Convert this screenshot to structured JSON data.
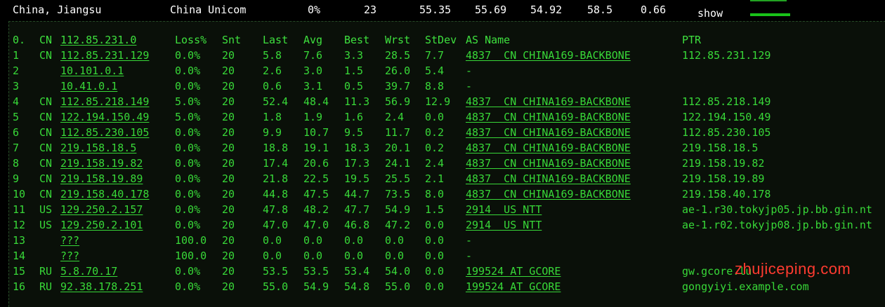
{
  "summary": {
    "location": "China, Jiangsu",
    "isp": "China Unicom",
    "loss": "0%",
    "sent": "23",
    "last": "55.35",
    "avg": "55.69",
    "best": "54.92",
    "worst": "58.5",
    "stdev": "0.66",
    "show_label": "show"
  },
  "table": {
    "headers": {
      "hop": "0.",
      "cc": "CN",
      "host": "112.85.231.0",
      "loss": "Loss%",
      "snt": "Snt",
      "last": "Last",
      "avg": "Avg",
      "best": "Best",
      "wrst": "Wrst",
      "stdev": "StDev",
      "asname": "AS Name",
      "ptr": "PTR"
    },
    "rows": [
      {
        "hop": "1",
        "cc": "CN",
        "host": "112.85.231.129",
        "loss": "0.0%",
        "snt": "20",
        "last": "5.8",
        "avg": "7.6",
        "best": "3.3",
        "wrst": "28.5",
        "stdev": "7.7",
        "asname": "4837  CN CHINA169-BACKBONE",
        "ptr": "112.85.231.129"
      },
      {
        "hop": "2",
        "cc": "",
        "host": "10.101.0.1",
        "loss": "0.0%",
        "snt": "20",
        "last": "2.6",
        "avg": "3.0",
        "best": "1.5",
        "wrst": "26.0",
        "stdev": "5.4",
        "asname": "-",
        "ptr": ""
      },
      {
        "hop": "3",
        "cc": "",
        "host": "10.41.0.1",
        "loss": "0.0%",
        "snt": "20",
        "last": "0.6",
        "avg": "3.1",
        "best": "0.5",
        "wrst": "39.7",
        "stdev": "8.8",
        "asname": "-",
        "ptr": ""
      },
      {
        "hop": "4",
        "cc": "CN",
        "host": "112.85.218.149",
        "loss": "5.0%",
        "snt": "20",
        "last": "52.4",
        "avg": "48.4",
        "best": "11.3",
        "wrst": "56.9",
        "stdev": "12.9",
        "asname": "4837  CN CHINA169-BACKBONE",
        "ptr": "112.85.218.149"
      },
      {
        "hop": "5",
        "cc": "CN",
        "host": "122.194.150.49",
        "loss": "5.0%",
        "snt": "20",
        "last": "1.8",
        "avg": "1.9",
        "best": "1.6",
        "wrst": "2.4",
        "stdev": "0.0",
        "asname": "4837  CN CHINA169-BACKBONE",
        "ptr": "122.194.150.49"
      },
      {
        "hop": "6",
        "cc": "CN",
        "host": "112.85.230.105",
        "loss": "0.0%",
        "snt": "20",
        "last": "9.9",
        "avg": "10.7",
        "best": "9.5",
        "wrst": "11.7",
        "stdev": "0.2",
        "asname": "4837  CN CHINA169-BACKBONE",
        "ptr": "112.85.230.105"
      },
      {
        "hop": "7",
        "cc": "CN",
        "host": "219.158.18.5",
        "loss": "0.0%",
        "snt": "20",
        "last": "18.8",
        "avg": "19.1",
        "best": "18.3",
        "wrst": "20.1",
        "stdev": "0.2",
        "asname": "4837  CN CHINA169-BACKBONE",
        "ptr": "219.158.18.5"
      },
      {
        "hop": "8",
        "cc": "CN",
        "host": "219.158.19.82",
        "loss": "0.0%",
        "snt": "20",
        "last": "17.4",
        "avg": "20.6",
        "best": "17.3",
        "wrst": "24.1",
        "stdev": "2.4",
        "asname": "4837  CN CHINA169-BACKBONE",
        "ptr": "219.158.19.82"
      },
      {
        "hop": "9",
        "cc": "CN",
        "host": "219.158.19.89",
        "loss": "0.0%",
        "snt": "20",
        "last": "21.8",
        "avg": "22.5",
        "best": "19.5",
        "wrst": "25.5",
        "stdev": "2.1",
        "asname": "4837  CN CHINA169-BACKBONE",
        "ptr": "219.158.19.89"
      },
      {
        "hop": "10",
        "cc": "CN",
        "host": "219.158.40.178",
        "loss": "0.0%",
        "snt": "20",
        "last": "44.8",
        "avg": "47.5",
        "best": "44.7",
        "wrst": "73.5",
        "stdev": "8.0",
        "asname": "4837  CN CHINA169-BACKBONE",
        "ptr": "219.158.40.178"
      },
      {
        "hop": "11",
        "cc": "US",
        "host": "129.250.2.157",
        "loss": "0.0%",
        "snt": "20",
        "last": "47.8",
        "avg": "48.2",
        "best": "47.7",
        "wrst": "54.9",
        "stdev": "1.5",
        "asname": "2914  US NTT",
        "ptr": "ae-1.r30.tokyjp05.jp.bb.gin.nt"
      },
      {
        "hop": "12",
        "cc": "US",
        "host": "129.250.2.101",
        "loss": "0.0%",
        "snt": "20",
        "last": "47.0",
        "avg": "47.0",
        "best": "46.8",
        "wrst": "47.2",
        "stdev": "0.0",
        "asname": "2914  US NTT",
        "ptr": "ae-1.r02.tokyjp08.jp.bb.gin.nt"
      },
      {
        "hop": "13",
        "cc": "",
        "host": "???",
        "loss": "100.0",
        "snt": "20",
        "last": "0.0",
        "avg": "0.0",
        "best": "0.0",
        "wrst": "0.0",
        "stdev": "0.0",
        "asname": "-",
        "ptr": ""
      },
      {
        "hop": "14",
        "cc": "",
        "host": "???",
        "loss": "100.0",
        "snt": "20",
        "last": "0.0",
        "avg": "0.0",
        "best": "0.0",
        "wrst": "0.0",
        "stdev": "0.0",
        "asname": "-",
        "ptr": ""
      },
      {
        "hop": "15",
        "cc": "RU",
        "host": "5.8.70.17",
        "loss": "0.0%",
        "snt": "20",
        "last": "53.5",
        "avg": "53.5",
        "best": "53.4",
        "wrst": "54.0",
        "stdev": "0.0",
        "asname": "199524 AT GCORE",
        "ptr": "gw.gcore.lu"
      },
      {
        "hop": "16",
        "cc": "RU",
        "host": "92.38.178.251",
        "loss": "0.0%",
        "snt": "20",
        "last": "55.0",
        "avg": "54.9",
        "best": "54.8",
        "wrst": "55.0",
        "stdev": "0.0",
        "asname": "199524 AT GCORE",
        "ptr": "gongyiyi.example.com"
      }
    ]
  },
  "watermark": "zhujiceping.com",
  "colors": {
    "terminal_green": "#38d838",
    "background": "#000000",
    "panel_background": "#0a1009",
    "watermark_red": "#ff3b30"
  }
}
